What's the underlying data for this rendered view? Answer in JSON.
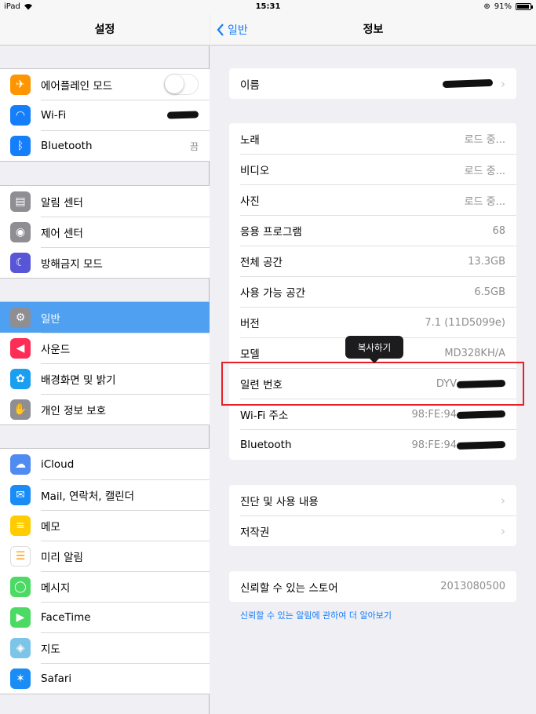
{
  "status": {
    "device": "iPad",
    "time": "15:31",
    "battery_text": "91%",
    "battery_level": 0.91
  },
  "left": {
    "title": "설정",
    "groups": [
      [
        {
          "label": "에어플레인 모드",
          "icon": "airplane-icon",
          "color": "#ff9500",
          "accessory": "toggle",
          "toggle_on": false
        },
        {
          "label": "Wi-Fi",
          "icon": "wifi-icon",
          "color": "#157efb",
          "accessory": "redacted"
        },
        {
          "label": "Bluetooth",
          "icon": "bluetooth-icon",
          "color": "#157efb",
          "value": "끔"
        }
      ],
      [
        {
          "label": "알림 센터",
          "icon": "notification-center-icon",
          "color": "#8e8e93"
        },
        {
          "label": "제어 센터",
          "icon": "control-center-icon",
          "color": "#8e8e93"
        },
        {
          "label": "방해금지 모드",
          "icon": "moon-icon",
          "color": "#5856d6"
        }
      ],
      [
        {
          "label": "일반",
          "icon": "gear-icon",
          "color": "#8e8e93",
          "selected": true
        },
        {
          "label": "사운드",
          "icon": "speaker-icon",
          "color": "#ff2d55"
        },
        {
          "label": "배경화면 및 밝기",
          "icon": "flower-icon",
          "color": "#1a9ff0"
        },
        {
          "label": "개인 정보 보호",
          "icon": "hand-icon",
          "color": "#8e8e93"
        }
      ],
      [
        {
          "label": "iCloud",
          "icon": "icloud-icon",
          "color": "#4f8bf0"
        },
        {
          "label": "Mail, 연락처, 캘린더",
          "icon": "mail-icon",
          "color": "#1a8cf5"
        },
        {
          "label": "메모",
          "icon": "notes-icon",
          "color": "#ffcc00"
        },
        {
          "label": "미리 알림",
          "icon": "reminders-icon",
          "color": "#ffffff"
        },
        {
          "label": "메시지",
          "icon": "messages-icon",
          "color": "#4cd964"
        },
        {
          "label": "FaceTime",
          "icon": "facetime-icon",
          "color": "#4cd964"
        },
        {
          "label": "지도",
          "icon": "maps-icon",
          "color": "#7cc4e8"
        },
        {
          "label": "Safari",
          "icon": "safari-icon",
          "color": "#1a8cf5"
        }
      ]
    ]
  },
  "right": {
    "back_label": "일반",
    "title": "정보",
    "groups": [
      [
        {
          "label": "이름",
          "redacted": true,
          "chevron": true
        }
      ],
      [
        {
          "label": "노래",
          "value": "로드 중..."
        },
        {
          "label": "비디오",
          "value": "로드 중..."
        },
        {
          "label": "사진",
          "value": "로드 중..."
        },
        {
          "label": "응용 프로그램",
          "value": "68"
        },
        {
          "label": "전체 공간",
          "value": "13.3GB"
        },
        {
          "label": "사용 가능 공간",
          "value": "6.5GB"
        },
        {
          "label": "버전",
          "value": "7.1 (11D5099e)"
        },
        {
          "label": "모델",
          "value": "MD328KH/A"
        },
        {
          "label": "일련 번호",
          "value": "DYV",
          "redacted": true
        },
        {
          "label": "Wi-Fi 주소",
          "value": "98:FE:94",
          "redacted": true
        },
        {
          "label": "Bluetooth",
          "value": "98:FE:94",
          "redacted": true
        }
      ],
      [
        {
          "label": "진단 및 사용 내용",
          "chevron": true
        },
        {
          "label": "저작권",
          "chevron": true
        }
      ],
      [
        {
          "label": "신뢰할 수 있는 스토어",
          "value": "2013080500"
        }
      ]
    ],
    "footer_link": "신뢰할 수 있는 알림에 관하여 더 알아보기",
    "tooltip": "복사하기"
  }
}
